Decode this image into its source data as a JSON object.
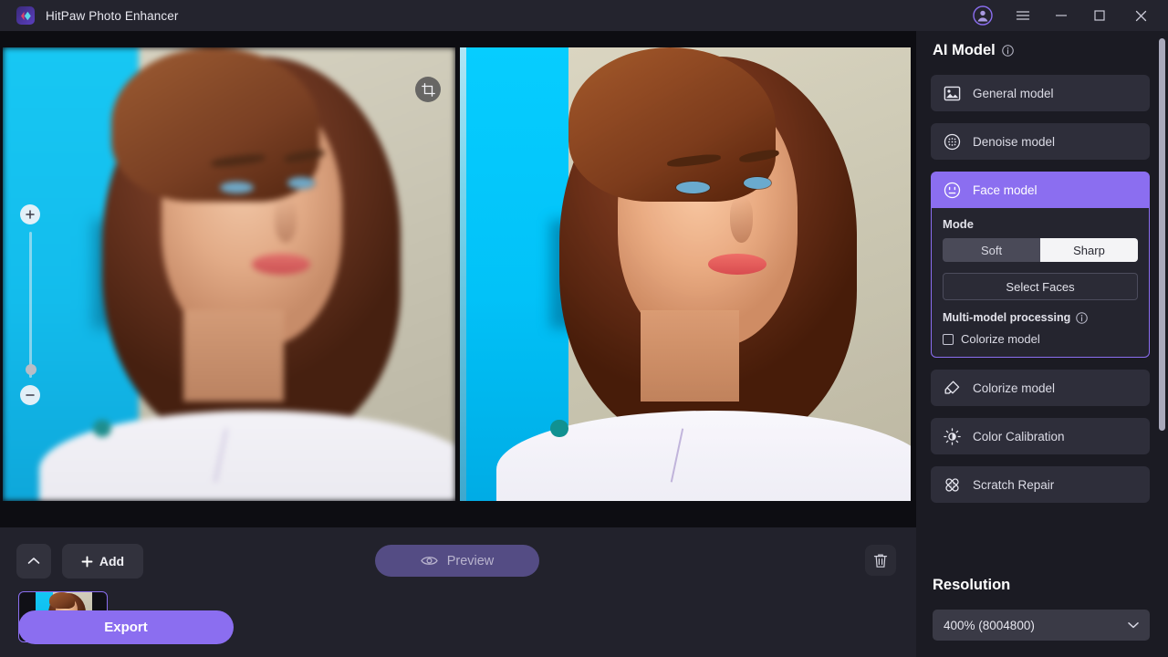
{
  "titlebar": {
    "app_name": "HitPaw Photo Enhancer",
    "logo_icon": "hitpaw-logo-icon",
    "controls": [
      {
        "name": "account-icon",
        "label": "Account"
      },
      {
        "name": "menu-icon",
        "label": "Menu"
      },
      {
        "name": "minimize-icon",
        "label": "Minimize"
      },
      {
        "name": "maximize-icon",
        "label": "Maximize"
      },
      {
        "name": "close-icon",
        "label": "Close"
      }
    ]
  },
  "canvas": {
    "crop_icon": "crop-icon",
    "zoom": {
      "plus_icon": "zoom-in-icon",
      "minus_icon": "zoom-out-icon",
      "handle_name": "zoom-slider-handle"
    },
    "before_pane": "original-image",
    "after_pane": "enhanced-image"
  },
  "bottombar": {
    "collapse_icon": "chevron-up-icon",
    "add_label": "Add",
    "add_icon": "plus-icon",
    "preview_label": "Preview",
    "preview_icon": "eye-icon",
    "delete_icon": "trash-icon",
    "thumbnail_badge_icon": "face-model-badge-icon"
  },
  "panel": {
    "title": "AI Model",
    "title_info_icon": "info-icon",
    "models": [
      {
        "label": "General model",
        "icon": "image-icon",
        "active": false
      },
      {
        "label": "Denoise model",
        "icon": "denoise-icon",
        "active": false
      },
      {
        "label": "Face model",
        "icon": "face-icon",
        "active": true
      },
      {
        "label": "Colorize model",
        "icon": "colorize-icon",
        "active": false
      },
      {
        "label": "Color Calibration",
        "icon": "brightness-icon",
        "active": false
      },
      {
        "label": "Scratch Repair",
        "icon": "bandage-icon",
        "active": false
      }
    ],
    "face_options": {
      "mode_label": "Mode",
      "mode_options": [
        "Soft",
        "Sharp"
      ],
      "mode_selected": "Sharp",
      "select_faces_label": "Select Faces",
      "multi_model_label": "Multi-model processing",
      "multi_model_info_icon": "info-icon",
      "colorize_checkbox_label": "Colorize model",
      "colorize_checked": false
    },
    "resolution": {
      "title": "Resolution",
      "selected": "400% (8004800)",
      "chevron_icon": "chevron-down-icon"
    },
    "export_label": "Export",
    "scrollbar_name": "panel-scrollbar"
  },
  "colors": {
    "accent": "#8b6ef0",
    "panel_bg": "#1b1b23",
    "titlebar_bg": "#24242e",
    "item_bg": "#2e2e3a",
    "bottombar_bg": "#22222c"
  }
}
